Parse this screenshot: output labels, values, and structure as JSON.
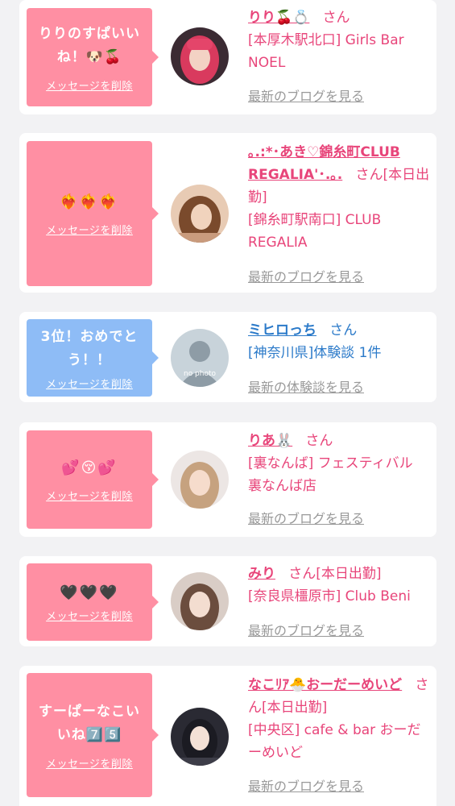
{
  "delete_label": "メッセージを削除",
  "san": "さん",
  "cards": [
    {
      "message": "りりのすぱいいね！🐶🍒",
      "name": "りり🍒💍",
      "status": "",
      "shop": "[本厚木駅北口] Girls Bar NOEL",
      "link": "最新のブログを見る"
    },
    {
      "message": "❤️‍🔥❤️‍🔥❤️‍🔥",
      "name": "｡.:*･あき♡錦糸町CLUB REGALIA'･.｡.",
      "status": "[本日出勤]",
      "shop": "[錦糸町駅南口] CLUB REGALIA",
      "link": "最新のブログを見る"
    },
    {
      "message": "3位！おめでとう！！",
      "name": "ミヒロっち",
      "status": "",
      "shop": "[神奈川県]体験談 1件",
      "link": "最新の体験談を見る",
      "avatar_text": "no photo"
    },
    {
      "message": "💕😚💕",
      "name": "りあ🐰",
      "status": "",
      "shop": "[裏なんば] フェスティバル 裏なんば店",
      "link": "最新のブログを見る"
    },
    {
      "message": "🖤🖤🖤",
      "name": "みり",
      "status": "[本日出勤]",
      "shop": "[奈良県橿原市] Club Beni",
      "link": "最新のブログを見る"
    },
    {
      "message": "すーぱーなこいいね7️⃣5️⃣",
      "name": "なこﾘｱ🐣おーだーめいど",
      "status": "[本日出勤]",
      "shop": "[中央区] cafe & bar おーだーめいど",
      "link": "最新のブログを見る"
    }
  ],
  "colors": {
    "pink_bubble": "#ff8fa3",
    "blue_bubble": "#8ebcf6",
    "pink_text": "#e8457a",
    "blue_text": "#2b7ac9",
    "background": "#f2f2f4"
  }
}
